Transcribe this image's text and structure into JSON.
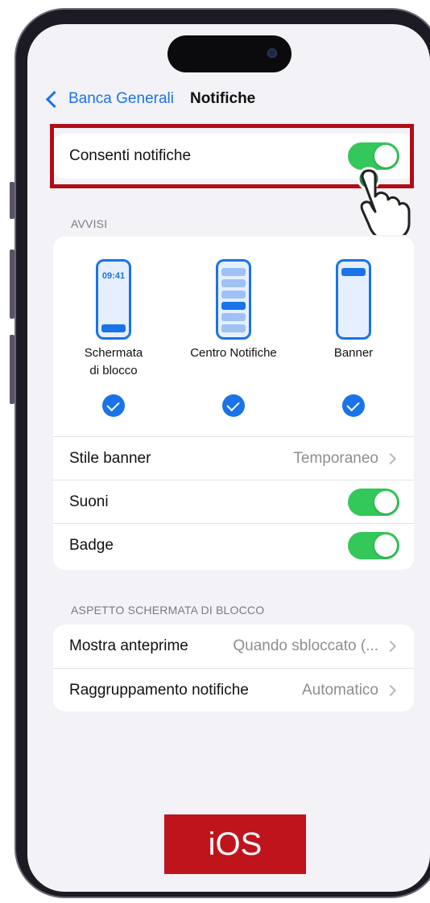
{
  "nav": {
    "back_label": "Banca Generali",
    "title": "Notifiche"
  },
  "allow_notifications": {
    "label": "Consenti notifiche",
    "enabled": true
  },
  "alerts": {
    "header": "AVVISI",
    "styles": [
      {
        "label_line1": "Schermata",
        "label_line2": "di blocco",
        "clock": "09:41",
        "checked": true
      },
      {
        "label_line1": "Centro Notifiche",
        "label_line2": "",
        "checked": true
      },
      {
        "label_line1": "Banner",
        "label_line2": "",
        "checked": true
      }
    ],
    "banner_style": {
      "label": "Stile banner",
      "value": "Temporaneo"
    },
    "sounds": {
      "label": "Suoni",
      "enabled": true
    },
    "badge": {
      "label": "Badge",
      "enabled": true
    }
  },
  "lock_screen": {
    "header": "ASPETTO SCHERMATA DI BLOCCO",
    "show_previews": {
      "label": "Mostra anteprime",
      "value": "Quando sbloccato (..."
    },
    "grouping": {
      "label": "Raggruppamento notifiche",
      "value": "Automatico"
    }
  },
  "platform_badge": "iOS",
  "colors": {
    "accent": "#1a73e8",
    "toggle_on": "#34c759",
    "highlight": "#b00d17",
    "badge": "#c0141c"
  },
  "icons": [
    "chevron-left-icon",
    "chevron-right-icon",
    "checkmark-icon",
    "hand-pointer-icon"
  ]
}
